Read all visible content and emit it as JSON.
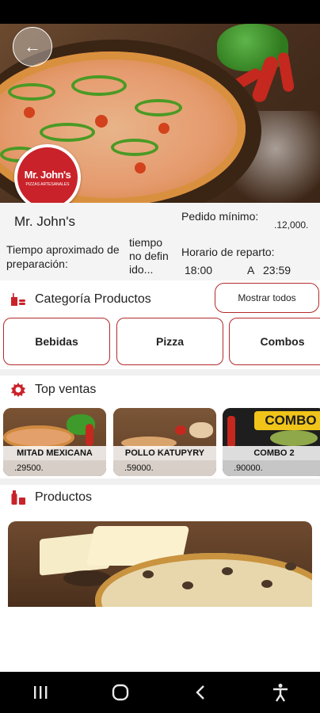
{
  "restaurant": {
    "name": "Mr. John's",
    "logo_text": "Mr. John's",
    "logo_subtext": "PIZZAS ARTESANALES",
    "min_order_label": "Pedido mínimo:",
    "min_order_value": ".12,000.",
    "prep_time_label": "Tiempo aproximado de preparación:",
    "prep_time_value": "tiempo no defin ido...",
    "delivery_hours_label": "Horario de reparto:",
    "delivery_from": "18:00",
    "delivery_sep": "A",
    "delivery_to": "23:59"
  },
  "categories": {
    "title": "Categoría Productos",
    "show_all_label": "Mostrar todos",
    "items": [
      {
        "label": "Bebidas"
      },
      {
        "label": "Pizza"
      },
      {
        "label": "Combos"
      }
    ]
  },
  "top_sales": {
    "title": "Top ventas",
    "items": [
      {
        "name": "MITAD MEXICANA",
        "price": ".29500."
      },
      {
        "name": "POLLO KATUPYRY",
        "price": ".59000."
      },
      {
        "name": "COMBO 2",
        "price": ".90000.",
        "banner": "COMBO"
      }
    ]
  },
  "products": {
    "title": "Productos"
  },
  "icons": {
    "back": "arrow-left-icon",
    "category": "fast-food-icon",
    "top_sales": "badge-icon",
    "products": "drink-bottle-icon",
    "nav_recent": "recent-apps-icon",
    "nav_home": "home-icon",
    "nav_back": "nav-back-icon",
    "nav_accessibility": "accessibility-icon"
  },
  "colors": {
    "accent": "#c9222a",
    "border_accent": "#b32a2a"
  }
}
